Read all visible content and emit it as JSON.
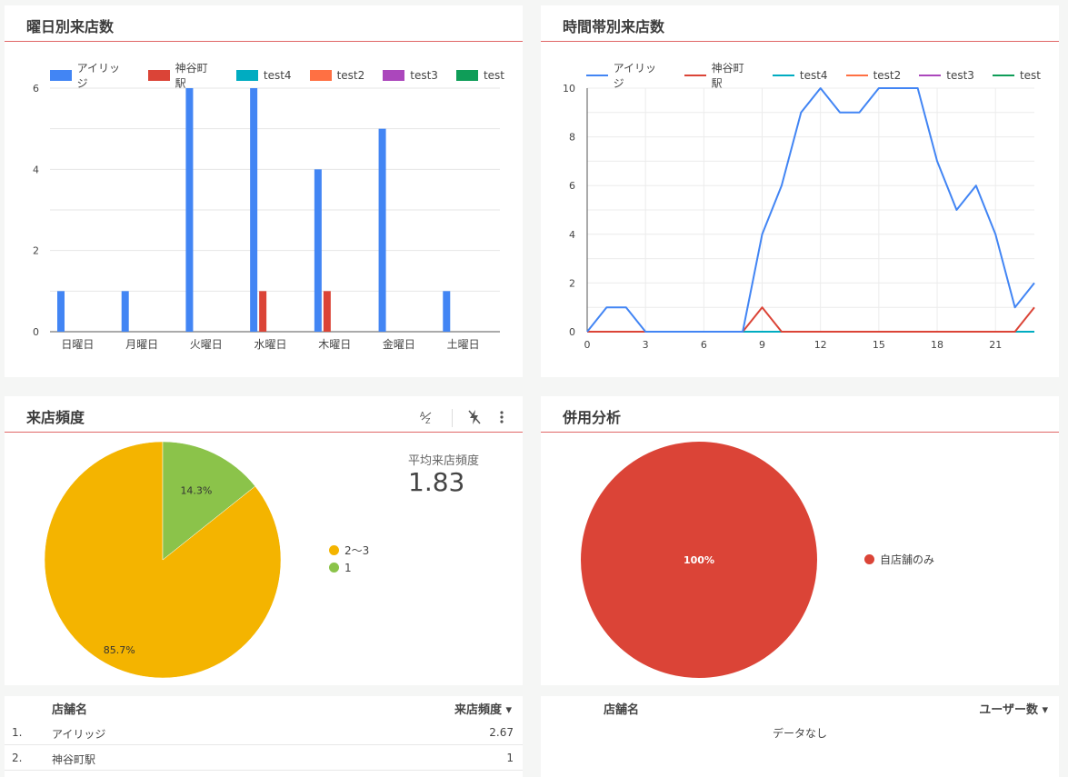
{
  "panels": {
    "weekday": {
      "title": "曜日別来店数"
    },
    "hourly": {
      "title": "時間帯別来店数"
    },
    "frequency": {
      "title": "来店頻度",
      "avg_label": "平均来店頻度",
      "avg_value": "1.83"
    },
    "cross": {
      "title": "併用分析"
    }
  },
  "colors": {
    "アイリッジ": "#4285f4",
    "神谷町駅": "#db4437",
    "test4": "#00acc1",
    "test2": "#ff7043",
    "test3": "#ab47bc",
    "test": "#0f9d58"
  },
  "chart_data": [
    {
      "type": "bar",
      "title": "曜日別来店数",
      "categories": [
        "日曜日",
        "月曜日",
        "火曜日",
        "水曜日",
        "木曜日",
        "金曜日",
        "土曜日"
      ],
      "series": [
        {
          "name": "アイリッジ",
          "values": [
            1,
            1,
            6,
            6,
            4,
            5,
            1
          ]
        },
        {
          "name": "神谷町駅",
          "values": [
            0,
            0,
            0,
            1,
            1,
            0,
            0
          ]
        },
        {
          "name": "test4",
          "values": [
            0,
            0,
            0,
            0,
            0,
            0,
            0
          ]
        },
        {
          "name": "test2",
          "values": [
            0,
            0,
            0,
            0,
            0,
            0,
            0
          ]
        },
        {
          "name": "test3",
          "values": [
            0,
            0,
            0,
            0,
            0,
            0,
            0
          ]
        },
        {
          "name": "test",
          "values": [
            0,
            0,
            0,
            0,
            0,
            0,
            0
          ]
        }
      ],
      "ylim": [
        0,
        6
      ],
      "yticks": [
        "0",
        "2",
        "4",
        "6"
      ],
      "legend": "top",
      "grid": true
    },
    {
      "type": "line",
      "title": "時間帯別来店数",
      "x": [
        0,
        1,
        2,
        3,
        4,
        5,
        6,
        7,
        8,
        9,
        10,
        11,
        12,
        13,
        14,
        15,
        16,
        17,
        18,
        19,
        20,
        21,
        22,
        23
      ],
      "series": [
        {
          "name": "アイリッジ",
          "values": [
            0,
            1,
            1,
            0,
            0,
            0,
            0,
            0,
            0,
            4,
            6,
            9,
            10,
            9,
            9,
            10,
            10,
            10,
            7,
            5,
            6,
            4,
            1,
            2
          ]
        },
        {
          "name": "神谷町駅",
          "values": [
            0,
            0,
            0,
            0,
            0,
            0,
            0,
            0,
            0,
            1,
            0,
            0,
            0,
            0,
            0,
            0,
            0,
            0,
            0,
            0,
            0,
            0,
            0,
            1
          ]
        },
        {
          "name": "test4",
          "values": [
            0,
            0,
            0,
            0,
            0,
            0,
            0,
            0,
            0,
            0,
            0,
            0,
            0,
            0,
            0,
            0,
            0,
            0,
            0,
            0,
            0,
            0,
            0,
            0
          ]
        },
        {
          "name": "test2",
          "values": [
            0,
            0,
            0,
            0,
            0,
            0,
            0,
            0,
            0,
            0,
            0,
            0,
            0,
            0,
            0,
            0,
            0,
            0,
            0,
            0,
            0,
            0,
            0,
            0
          ]
        },
        {
          "name": "test3",
          "values": [
            0,
            0,
            0,
            0,
            0,
            0,
            0,
            0,
            0,
            0,
            0,
            0,
            0,
            0,
            0,
            0,
            0,
            0,
            0,
            0,
            0,
            0,
            0,
            0
          ]
        },
        {
          "name": "test",
          "values": [
            0,
            0,
            0,
            0,
            0,
            0,
            0,
            0,
            0,
            0,
            0,
            0,
            0,
            0,
            0,
            0,
            0,
            0,
            0,
            0,
            0,
            0,
            0,
            0
          ]
        }
      ],
      "xlim": [
        0,
        23
      ],
      "xticks": [
        "0",
        "3",
        "6",
        "9",
        "12",
        "15",
        "18",
        "21"
      ],
      "ylim": [
        0,
        10
      ],
      "yticks": [
        "0",
        "2",
        "4",
        "6",
        "8",
        "10"
      ],
      "legend": "top",
      "grid": true
    },
    {
      "type": "pie",
      "title": "来店頻度",
      "slices": [
        {
          "label": "2〜3",
          "value": 85.7,
          "display": "85.7%",
          "color": "#f4b400"
        },
        {
          "label": "1",
          "value": 14.3,
          "display": "14.3%",
          "color": "#8bc34a"
        }
      ],
      "legend": "right"
    },
    {
      "type": "pie",
      "title": "併用分析",
      "slices": [
        {
          "label": "自店舗のみ",
          "value": 100,
          "display": "100%",
          "color": "#db4437"
        }
      ],
      "legend": "right"
    }
  ],
  "tables": {
    "frequency": {
      "headers": [
        "店舗名",
        "来店頻度 ▾"
      ],
      "rows": [
        {
          "index": "1.",
          "name": "アイリッジ",
          "value": "2.67"
        },
        {
          "index": "2.",
          "name": "神谷町駅",
          "value": "1"
        }
      ]
    },
    "users": {
      "headers": [
        "店舗名",
        "ユーザー数 ▾"
      ],
      "empty": "データなし"
    }
  },
  "icons": [
    "sort-az-icon",
    "flash-off-icon",
    "more-vert-icon"
  ]
}
